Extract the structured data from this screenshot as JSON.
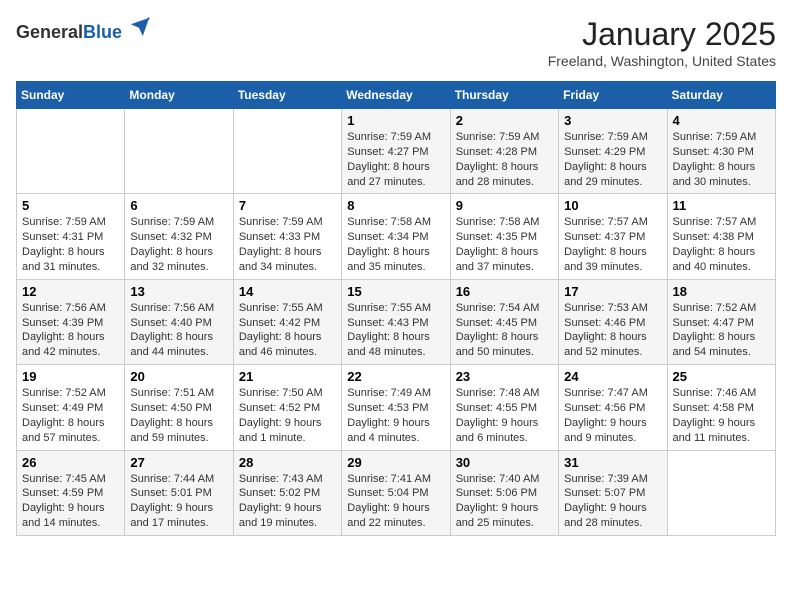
{
  "header": {
    "logo_general": "General",
    "logo_blue": "Blue",
    "month_title": "January 2025",
    "location": "Freeland, Washington, United States"
  },
  "weekdays": [
    "Sunday",
    "Monday",
    "Tuesday",
    "Wednesday",
    "Thursday",
    "Friday",
    "Saturday"
  ],
  "weeks": [
    [
      {
        "day": null,
        "content": null
      },
      {
        "day": null,
        "content": null
      },
      {
        "day": null,
        "content": null
      },
      {
        "day": "1",
        "content": "Sunrise: 7:59 AM\nSunset: 4:27 PM\nDaylight: 8 hours and 27 minutes."
      },
      {
        "day": "2",
        "content": "Sunrise: 7:59 AM\nSunset: 4:28 PM\nDaylight: 8 hours and 28 minutes."
      },
      {
        "day": "3",
        "content": "Sunrise: 7:59 AM\nSunset: 4:29 PM\nDaylight: 8 hours and 29 minutes."
      },
      {
        "day": "4",
        "content": "Sunrise: 7:59 AM\nSunset: 4:30 PM\nDaylight: 8 hours and 30 minutes."
      }
    ],
    [
      {
        "day": "5",
        "content": "Sunrise: 7:59 AM\nSunset: 4:31 PM\nDaylight: 8 hours and 31 minutes."
      },
      {
        "day": "6",
        "content": "Sunrise: 7:59 AM\nSunset: 4:32 PM\nDaylight: 8 hours and 32 minutes."
      },
      {
        "day": "7",
        "content": "Sunrise: 7:59 AM\nSunset: 4:33 PM\nDaylight: 8 hours and 34 minutes."
      },
      {
        "day": "8",
        "content": "Sunrise: 7:58 AM\nSunset: 4:34 PM\nDaylight: 8 hours and 35 minutes."
      },
      {
        "day": "9",
        "content": "Sunrise: 7:58 AM\nSunset: 4:35 PM\nDaylight: 8 hours and 37 minutes."
      },
      {
        "day": "10",
        "content": "Sunrise: 7:57 AM\nSunset: 4:37 PM\nDaylight: 8 hours and 39 minutes."
      },
      {
        "day": "11",
        "content": "Sunrise: 7:57 AM\nSunset: 4:38 PM\nDaylight: 8 hours and 40 minutes."
      }
    ],
    [
      {
        "day": "12",
        "content": "Sunrise: 7:56 AM\nSunset: 4:39 PM\nDaylight: 8 hours and 42 minutes."
      },
      {
        "day": "13",
        "content": "Sunrise: 7:56 AM\nSunset: 4:40 PM\nDaylight: 8 hours and 44 minutes."
      },
      {
        "day": "14",
        "content": "Sunrise: 7:55 AM\nSunset: 4:42 PM\nDaylight: 8 hours and 46 minutes."
      },
      {
        "day": "15",
        "content": "Sunrise: 7:55 AM\nSunset: 4:43 PM\nDaylight: 8 hours and 48 minutes."
      },
      {
        "day": "16",
        "content": "Sunrise: 7:54 AM\nSunset: 4:45 PM\nDaylight: 8 hours and 50 minutes."
      },
      {
        "day": "17",
        "content": "Sunrise: 7:53 AM\nSunset: 4:46 PM\nDaylight: 8 hours and 52 minutes."
      },
      {
        "day": "18",
        "content": "Sunrise: 7:52 AM\nSunset: 4:47 PM\nDaylight: 8 hours and 54 minutes."
      }
    ],
    [
      {
        "day": "19",
        "content": "Sunrise: 7:52 AM\nSunset: 4:49 PM\nDaylight: 8 hours and 57 minutes."
      },
      {
        "day": "20",
        "content": "Sunrise: 7:51 AM\nSunset: 4:50 PM\nDaylight: 8 hours and 59 minutes."
      },
      {
        "day": "21",
        "content": "Sunrise: 7:50 AM\nSunset: 4:52 PM\nDaylight: 9 hours and 1 minute."
      },
      {
        "day": "22",
        "content": "Sunrise: 7:49 AM\nSunset: 4:53 PM\nDaylight: 9 hours and 4 minutes."
      },
      {
        "day": "23",
        "content": "Sunrise: 7:48 AM\nSunset: 4:55 PM\nDaylight: 9 hours and 6 minutes."
      },
      {
        "day": "24",
        "content": "Sunrise: 7:47 AM\nSunset: 4:56 PM\nDaylight: 9 hours and 9 minutes."
      },
      {
        "day": "25",
        "content": "Sunrise: 7:46 AM\nSunset: 4:58 PM\nDaylight: 9 hours and 11 minutes."
      }
    ],
    [
      {
        "day": "26",
        "content": "Sunrise: 7:45 AM\nSunset: 4:59 PM\nDaylight: 9 hours and 14 minutes."
      },
      {
        "day": "27",
        "content": "Sunrise: 7:44 AM\nSunset: 5:01 PM\nDaylight: 9 hours and 17 minutes."
      },
      {
        "day": "28",
        "content": "Sunrise: 7:43 AM\nSunset: 5:02 PM\nDaylight: 9 hours and 19 minutes."
      },
      {
        "day": "29",
        "content": "Sunrise: 7:41 AM\nSunset: 5:04 PM\nDaylight: 9 hours and 22 minutes."
      },
      {
        "day": "30",
        "content": "Sunrise: 7:40 AM\nSunset: 5:06 PM\nDaylight: 9 hours and 25 minutes."
      },
      {
        "day": "31",
        "content": "Sunrise: 7:39 AM\nSunset: 5:07 PM\nDaylight: 9 hours and 28 minutes."
      },
      {
        "day": null,
        "content": null
      }
    ]
  ]
}
